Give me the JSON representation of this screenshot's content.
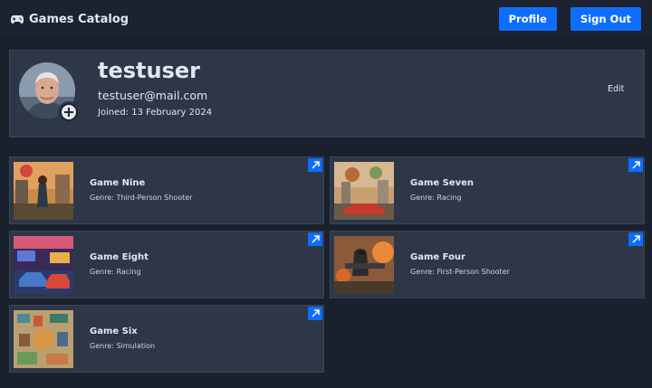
{
  "navbar": {
    "brand": "Games Catalog",
    "brand_icon": "gamepad-icon",
    "profile_label": "Profile",
    "signout_label": "Sign Out"
  },
  "profile": {
    "username": "testuser",
    "email": "testuser@mail.com",
    "joined": "Joined: 13 February 2024",
    "edit_label": "Edit"
  },
  "games": [
    {
      "name": "Game Nine",
      "genre": "Genre: Third-Person Shooter"
    },
    {
      "name": "Game Seven",
      "genre": "Genre: Racing"
    },
    {
      "name": "Game Eight",
      "genre": "Genre: Racing"
    },
    {
      "name": "Game Four",
      "genre": "Genre: First-Person Shooter"
    },
    {
      "name": "Game Six",
      "genre": "Genre: Simulation"
    }
  ],
  "colors": {
    "background": "#1a202c",
    "card": "#2d3748",
    "accent": "#0d6efd"
  }
}
